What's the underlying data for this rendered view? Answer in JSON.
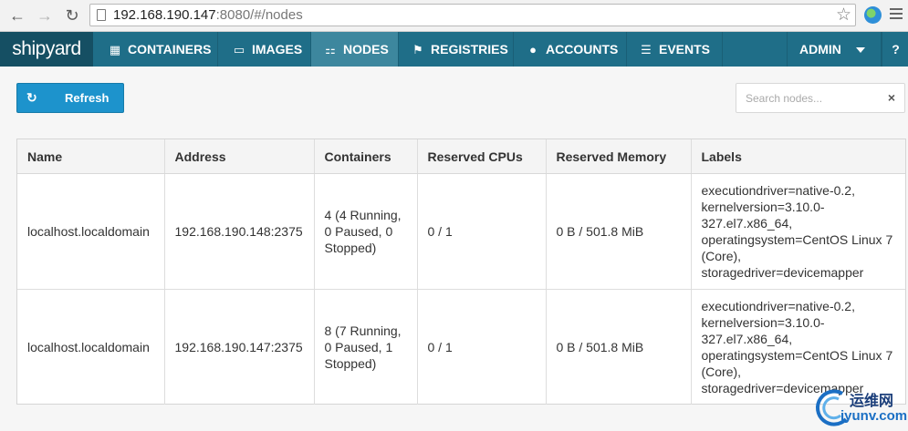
{
  "browser": {
    "url_host": "192.168.190.147",
    "url_rest": ":8080/#/nodes"
  },
  "navbar": {
    "brand": "shipyard",
    "items": [
      {
        "label": "CONTAINERS",
        "icon": "grid-icon"
      },
      {
        "label": "IMAGES",
        "icon": "drive-icon"
      },
      {
        "label": "NODES",
        "icon": "sitemap-icon"
      },
      {
        "label": "REGISTRIES",
        "icon": "flag-icon"
      },
      {
        "label": "ACCOUNTS",
        "icon": "user-icon"
      },
      {
        "label": "EVENTS",
        "icon": "list-icon"
      }
    ],
    "active": "NODES",
    "user": "ADMIN",
    "help": "?"
  },
  "toolbar": {
    "refresh_label": "Refresh",
    "search_placeholder": "Search nodes..."
  },
  "table": {
    "columns": [
      "Name",
      "Address",
      "Containers",
      "Reserved CPUs",
      "Reserved Memory",
      "Labels"
    ],
    "rows": [
      {
        "name": "localhost.localdomain",
        "address": "192.168.190.148:2375",
        "containers": "4 (4 Running, 0 Paused, 0 Stopped)",
        "cpus": "0 / 1",
        "memory": "0 B / 501.8 MiB",
        "labels": [
          "executiondriver=native-0.2,",
          "kernelversion=3.10.0-327.el7.x86_64,",
          "operatingsystem=CentOS Linux 7 (Core),",
          "storagedriver=devicemapper"
        ]
      },
      {
        "name": "localhost.localdomain",
        "address": "192.168.190.147:2375",
        "containers": "8 (7 Running, 0 Paused, 1 Stopped)",
        "cpus": "0 / 1",
        "memory": "0 B / 501.8 MiB",
        "labels": [
          "executiondriver=native-0.2,",
          "kernelversion=3.10.0-327.el7.x86_64,",
          "operatingsystem=CentOS Linux 7 (Core),",
          "storagedriver=devicemapper"
        ]
      }
    ]
  },
  "watermark": {
    "line1": "运维网",
    "line2": "iyunv.com"
  }
}
